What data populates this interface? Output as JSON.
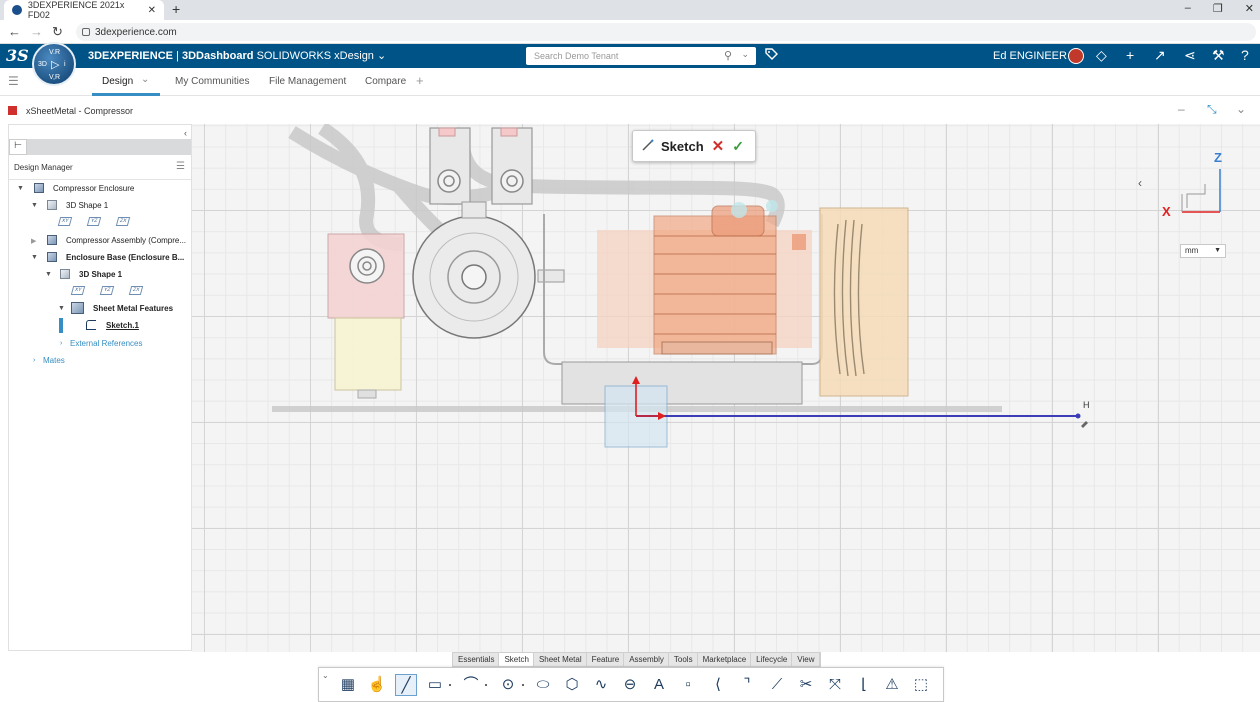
{
  "browser": {
    "tab_title": "3DEXPERIENCE 2021x FD02",
    "tab_close": "✕",
    "new_tab": "+",
    "url": "3dexperience.com",
    "nav_back": "←",
    "nav_forward": "→",
    "nav_reload": "↻",
    "win_min": "–",
    "win_max": "❐",
    "win_close": "✕"
  },
  "header": {
    "brand_logo": "3S",
    "compass": {
      "top": "V.R",
      "left": "3D",
      "center": "▷",
      "right": "i",
      "bottom": "V,R"
    },
    "app_bold": "3DEXPERIENCE",
    "app_sep": " | ",
    "dashboard": "3DDashboard",
    "app_name": "SOLIDWORKS xDesign",
    "app_caret": "⌄",
    "search_placeholder": "Search Demo Tenant",
    "search_icon": "⚲",
    "search_caret": "⌄",
    "tag_icon": "⌂",
    "user_name": "Ed ENGINEER",
    "icons": [
      "tag-plus-icon",
      "add-icon",
      "share-icon",
      "social-icon",
      "tools-icon",
      "help-icon"
    ],
    "icon_glyphs": [
      "◇",
      "+",
      "↗",
      "⋖",
      "⚒",
      "?"
    ]
  },
  "dashboard_tabs": {
    "menu_icon": "☰",
    "items": [
      {
        "label": "Design",
        "active": true
      },
      {
        "label": "My Communities"
      },
      {
        "label": "File Management"
      },
      {
        "label": "Compare"
      }
    ],
    "design_caret": "⌄",
    "add": "+"
  },
  "widget": {
    "title": "xSheetMetal - Compressor",
    "ctl_min": "–",
    "ctl_expand": "⤡",
    "ctl_menu": "⌄"
  },
  "left_panel": {
    "collapse": "‹",
    "tree_btn": "⊢",
    "title": "Design Manager",
    "menu": "☰",
    "tree": [
      {
        "label": "Compressor Enclosure"
      },
      {
        "label": "3D Shape 1"
      },
      {
        "label": "Compressor Assembly  (Compre..."
      },
      {
        "label": "Enclosure Base (Enclosure B..."
      },
      {
        "label": "3D Shape 1"
      },
      {
        "label": "Sheet Metal Features"
      },
      {
        "label": "Sketch.1"
      },
      {
        "label": "External References"
      },
      {
        "label": "Mates"
      }
    ],
    "planes": [
      "XY",
      "YZ",
      "ZX"
    ]
  },
  "canvas": {
    "sketch_label": "Sketch",
    "sketch_cancel": "✕",
    "sketch_ok": "✓",
    "constraint_h": "H",
    "axis_z": "Z",
    "axis_x": "X",
    "view_back": "‹",
    "units": "mm",
    "units_caret": "▼"
  },
  "action_bar": {
    "handle": "⌄",
    "tabs": [
      "Essentials",
      "Sketch",
      "Sheet Metal",
      "Feature",
      "Assembly",
      "Tools",
      "Marketplace",
      "Lifecycle",
      "View"
    ],
    "active_tab": "Sketch",
    "tools": [
      {
        "name": "grid-icon",
        "glyph": "▦"
      },
      {
        "name": "select-icon",
        "glyph": "☝"
      },
      {
        "name": "line-icon",
        "glyph": "╱",
        "active": true
      },
      {
        "name": "rectangle-icon",
        "glyph": "▭",
        "more": true
      },
      {
        "name": "arc-icon",
        "glyph": "⌒",
        "more": true
      },
      {
        "name": "circle-icon",
        "glyph": "⊙",
        "more": true
      },
      {
        "name": "ellipse-icon",
        "glyph": "⬭"
      },
      {
        "name": "polygon-icon",
        "glyph": "⬡"
      },
      {
        "name": "spline-icon",
        "glyph": "∿"
      },
      {
        "name": "slot-icon",
        "glyph": "⊖"
      },
      {
        "name": "text-icon",
        "glyph": "A"
      },
      {
        "name": "point-icon",
        "glyph": "▫"
      },
      {
        "name": "fillet-icon",
        "glyph": "⟨"
      },
      {
        "name": "chamfer-icon",
        "glyph": "⌝"
      },
      {
        "name": "offset-icon",
        "glyph": "⟋"
      },
      {
        "name": "trim-icon",
        "glyph": "✂"
      },
      {
        "name": "extend-icon",
        "glyph": "⤧"
      },
      {
        "name": "convert-icon",
        "glyph": "⌊"
      },
      {
        "name": "constraint-icon",
        "glyph": "⚠"
      },
      {
        "name": "box-icon",
        "glyph": "⬚"
      }
    ]
  }
}
